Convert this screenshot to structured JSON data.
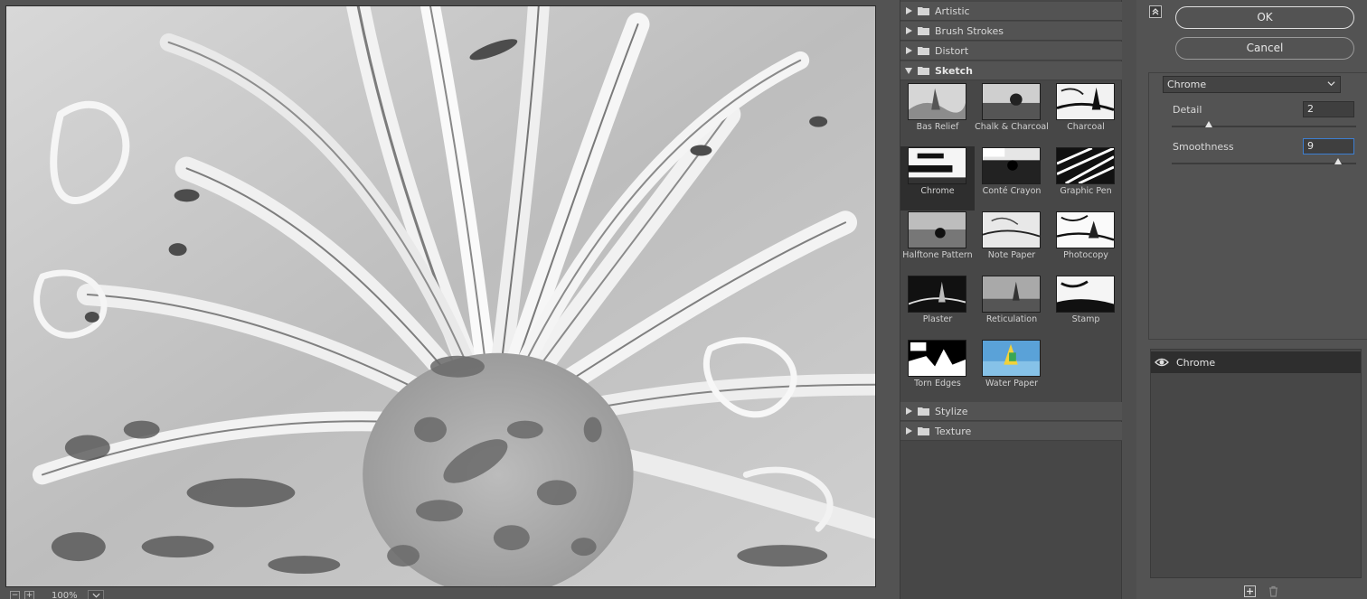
{
  "preview": {
    "zoom": "100%"
  },
  "gallery": {
    "folders_top": [
      {
        "label": "Artistic"
      },
      {
        "label": "Brush Strokes"
      },
      {
        "label": "Distort"
      },
      {
        "label": "Sketch"
      }
    ],
    "sketch_filters": [
      {
        "label": "Bas Relief"
      },
      {
        "label": "Chalk & Charcoal"
      },
      {
        "label": "Charcoal"
      },
      {
        "label": "Chrome"
      },
      {
        "label": "Conté Crayon"
      },
      {
        "label": "Graphic Pen"
      },
      {
        "label": "Halftone Pattern"
      },
      {
        "label": "Note Paper"
      },
      {
        "label": "Photocopy"
      },
      {
        "label": "Plaster"
      },
      {
        "label": "Reticulation"
      },
      {
        "label": "Stamp"
      },
      {
        "label": "Torn Edges"
      },
      {
        "label": "Water Paper"
      }
    ],
    "folders_bottom": [
      {
        "label": "Stylize"
      },
      {
        "label": "Texture"
      }
    ],
    "selected_filter": "Chrome"
  },
  "settings": {
    "ok_label": "OK",
    "cancel_label": "Cancel",
    "filter_select": "Chrome",
    "params": [
      {
        "label": "Detail",
        "value": "2",
        "level": 0.2
      },
      {
        "label": "Smoothness",
        "value": "9",
        "level": 0.9
      }
    ]
  },
  "layers": {
    "items": [
      {
        "name": "Chrome",
        "visible": true
      }
    ]
  },
  "icons": [
    "collapse-icon",
    "folder-icon",
    "triangle-right-icon",
    "triangle-down-icon",
    "chevron-down-icon",
    "eye-icon",
    "new-layer-icon",
    "trash-icon"
  ],
  "colors": {
    "panel": "#535353",
    "gallery": "#474747",
    "selected": "#2e2e2e",
    "focus": "#3d7fd2"
  }
}
